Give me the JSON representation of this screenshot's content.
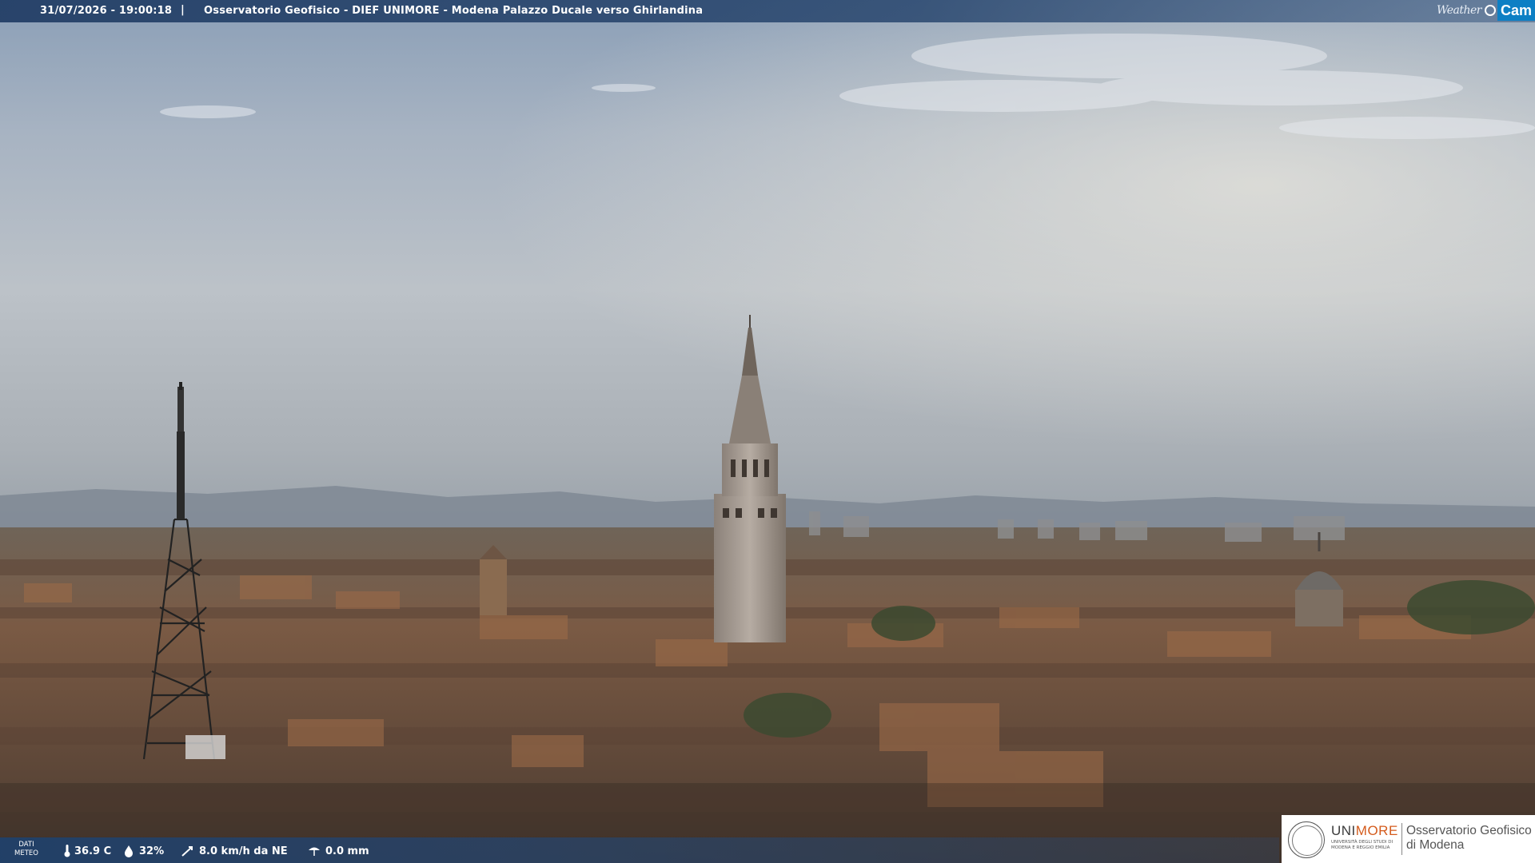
{
  "header": {
    "datetime": "31/07/2026 - 19:00:18",
    "separator": "|",
    "title": "Osservatorio Geofisico - DIEF UNIMORE - Modena Palazzo Ducale verso Ghirlandina"
  },
  "brand": {
    "weather_text": "Weather",
    "cam_text": "Cam"
  },
  "meteo": {
    "label_line1": "DATI",
    "label_line2": "METEO",
    "temperature": "36.9 C",
    "humidity": "32%",
    "wind": "8.0 km/h da NE",
    "rain": "0.0 mm",
    "icons": [
      "thermometer-icon",
      "humidity-drop-icon",
      "wind-icon",
      "rain-icon"
    ]
  },
  "logo": {
    "uni_part1": "UNI",
    "uni_part2": "MORE",
    "uni_subtitle": "UNIVERSITÀ DEGLI STUDI DI MODENA E REGGIO EMILIA",
    "observatory_line1": "Osservatorio Geofisico",
    "observatory_line2": "di Modena"
  },
  "colors": {
    "bar_blue": "#1e416e",
    "cam_blue": "#0d7fc4",
    "unimore_orange": "#d45b1c"
  }
}
